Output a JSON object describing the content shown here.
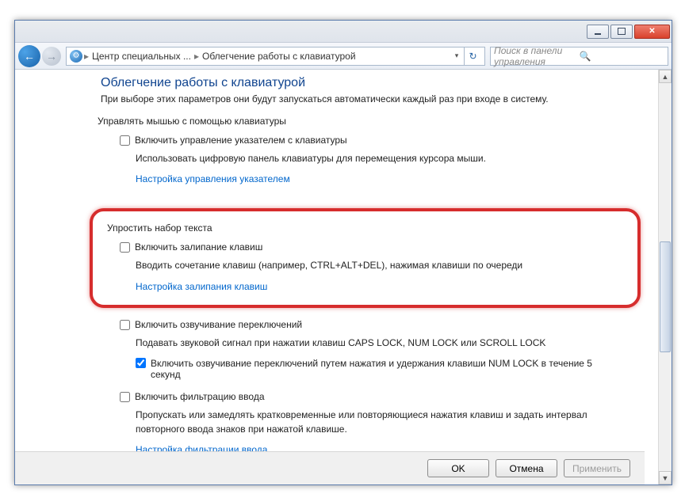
{
  "titlebar": {
    "min": "minimize",
    "max": "maximize",
    "close": "close"
  },
  "nav": {
    "crumb1": "Центр специальных ...",
    "crumb2": "Облегчение работы с клавиатурой",
    "search_placeholder": "Поиск в панели управления"
  },
  "page": {
    "title": "Облегчение работы с клавиатурой",
    "subtitle": "При выборе этих параметров они будут запускаться автоматически каждый раз при входе в систему."
  },
  "mouse_group": {
    "title": "Управлять мышью с помощью клавиатуры",
    "opt1_label": "Включить управление указателем с клавиатуры",
    "opt1_checked": false,
    "desc": "Использовать цифровую панель клавиатуры для перемещения курсора мыши.",
    "link": "Настройка управления указателем"
  },
  "text_group": {
    "title": "Упростить набор текста",
    "sticky_label": "Включить залипание клавиш",
    "sticky_checked": false,
    "sticky_desc": "Вводить сочетание клавиш (например, CTRL+ALT+DEL), нажимая клавиши по очереди",
    "sticky_link": "Настройка залипания клавиш",
    "toggle_label": "Включить озвучивание переключений",
    "toggle_checked": false,
    "toggle_desc": "Подавать звуковой сигнал при нажатии клавиш CAPS LOCK, NUM LOCK или SCROLL LOCK",
    "toggle_sub_label": "Включить озвучивание переключений путем нажатия и удержания клавиши NUM LOCK в течение 5 секунд",
    "toggle_sub_checked": true,
    "filter_label": "Включить фильтрацию ввода",
    "filter_checked": false,
    "filter_desc": "Пропускать или замедлять кратковременные или повторяющиеся нажатия клавиш и задать интервал повторного ввода знаков при нажатой клавише.",
    "filter_link": "Настройка фильтрации ввода"
  },
  "buttons": {
    "ok": "OK",
    "cancel": "Отмена",
    "apply": "Применить"
  }
}
